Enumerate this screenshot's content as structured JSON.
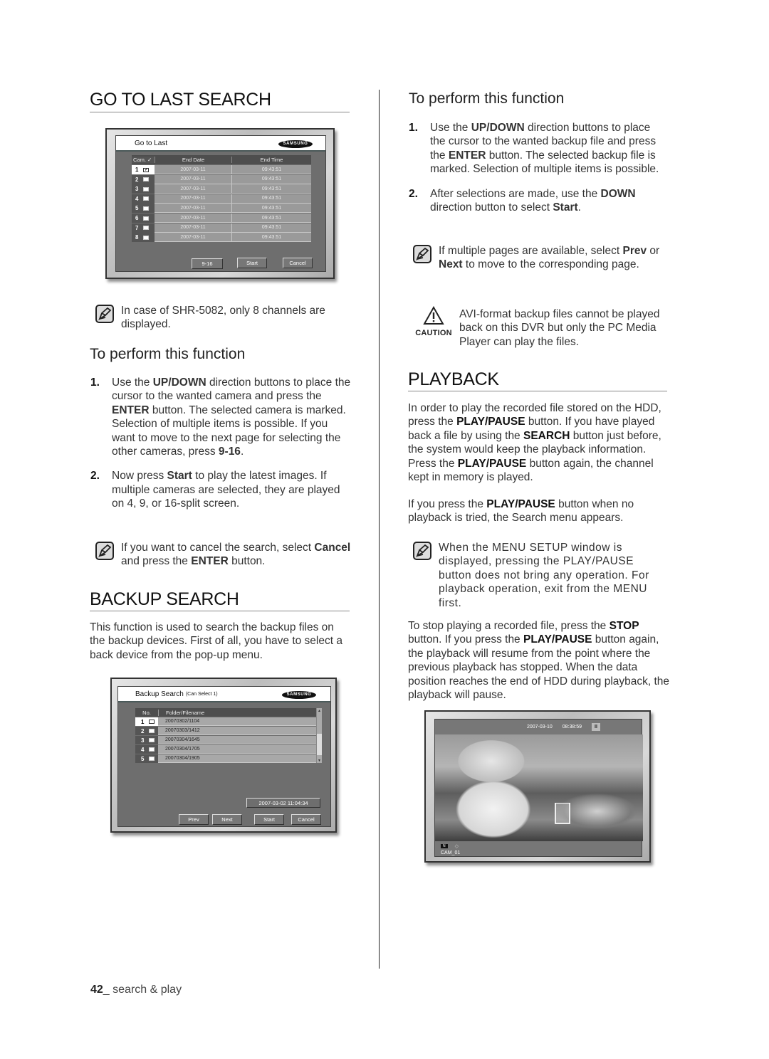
{
  "left": {
    "go_to_last": {
      "heading": "GO TO LAST SEARCH",
      "dialog": {
        "title": "Go to Last",
        "brand": "SAMSUNG",
        "columns": [
          "Cam.",
          "End Date",
          "End Time"
        ],
        "rows": [
          {
            "cam": "1",
            "checked": true,
            "date": "2007-03-11",
            "time": "09:43:51"
          },
          {
            "cam": "2",
            "checked": false,
            "date": "2007-03-11",
            "time": "09:43:51"
          },
          {
            "cam": "3",
            "checked": false,
            "date": "2007-03-11",
            "time": "09:43:51"
          },
          {
            "cam": "4",
            "checked": false,
            "date": "2007-03-11",
            "time": "09:43:51"
          },
          {
            "cam": "5",
            "checked": false,
            "date": "2007-03-11",
            "time": "09:43:51"
          },
          {
            "cam": "6",
            "checked": false,
            "date": "2007-03-11",
            "time": "09:43:51"
          },
          {
            "cam": "7",
            "checked": false,
            "date": "2007-03-11",
            "time": "09:43:51"
          },
          {
            "cam": "8",
            "checked": false,
            "date": "2007-03-11",
            "time": "09:43:51"
          }
        ],
        "buttons": {
          "page": "9-16",
          "start": "Start",
          "cancel": "Cancel"
        }
      },
      "note": "In case of SHR-5082, only 8 channels are displayed.",
      "subheading": "To perform this function",
      "steps": [
        {
          "num": "1.",
          "parts": [
            [
              "Use the ",
              false
            ],
            [
              "UP/DOWN",
              true
            ],
            [
              " direction buttons to place the cursor to the wanted camera and press the ",
              false
            ],
            [
              "ENTER",
              true
            ],
            [
              " button. The selected camera is marked. Selection of multiple items is possible. If you want to move to the next page for selecting the other cameras, press ",
              false
            ],
            [
              "9-16",
              true
            ],
            [
              ".",
              false
            ]
          ]
        },
        {
          "num": "2.",
          "parts": [
            [
              "Now press ",
              false
            ],
            [
              "Start",
              true
            ],
            [
              " to play the latest images. If multiple cameras are selected, they are played on 4, 9, or 16-split screen.",
              false
            ]
          ]
        }
      ],
      "note2_parts": [
        [
          "If you want to cancel the search, select ",
          false
        ],
        [
          "Cancel",
          true
        ],
        [
          " and press the ",
          false
        ],
        [
          "ENTER",
          true
        ],
        [
          " button.",
          false
        ]
      ]
    },
    "backup": {
      "heading": "BACKUP SEARCH",
      "intro": "This function is used to search the backup files on the backup devices. First of all, you have to select a back device from the pop-up menu.",
      "dialog": {
        "title": "Backup Search",
        "title_suffix": "(Can Select 1)",
        "brand": "SAMSUNG",
        "columns": [
          "No.",
          "Folder/Filename"
        ],
        "rows": [
          {
            "no": "1",
            "name": "20070302/1104"
          },
          {
            "no": "2",
            "name": "20070303/1412"
          },
          {
            "no": "3",
            "name": "20070304/1645"
          },
          {
            "no": "4",
            "name": "20070304/1705"
          },
          {
            "no": "5",
            "name": "20070304/1905"
          }
        ],
        "datetime": "2007-03-02  11:04:34",
        "buttons": {
          "prev": "Prev",
          "next": "Next",
          "start": "Start",
          "cancel": "Cancel"
        }
      }
    }
  },
  "right": {
    "subheading": "To perform this function",
    "steps": [
      {
        "num": "1.",
        "parts": [
          [
            "Use the ",
            false
          ],
          [
            "UP/DOWN",
            true
          ],
          [
            " direction buttons to place the cursor to the wanted backup file and press the ",
            false
          ],
          [
            "ENTER",
            true
          ],
          [
            " button. The selected backup file is marked. Selection of multiple items is possible.",
            false
          ]
        ]
      },
      {
        "num": "2.",
        "parts": [
          [
            "After selections are made, use the ",
            false
          ],
          [
            "DOWN",
            true
          ],
          [
            " direction button to select ",
            false
          ],
          [
            "Start",
            true
          ],
          [
            ".",
            false
          ]
        ]
      }
    ],
    "note_parts": [
      [
        "If multiple pages are available, select ",
        false
      ],
      [
        "Prev",
        true
      ],
      [
        " or ",
        false
      ],
      [
        "Next",
        true
      ],
      [
        " to move to the corresponding page.",
        false
      ]
    ],
    "caution": {
      "label": "CAUTION",
      "text": "AVI-format backup files cannot be played back on this DVR but only the PC Media Player can play the files."
    },
    "playback": {
      "heading": "PLAYBACK",
      "para1_parts": [
        [
          "In order to play the recorded file stored on the HDD, press the ",
          false
        ],
        [
          "PLAY/PAUSE",
          true
        ],
        [
          " button. If you have played back a file by using the ",
          false
        ],
        [
          "SEARCH",
          true
        ],
        [
          " button just before, the system would keep the playback information. Press the ",
          false
        ],
        [
          "PLAY/PAUSE",
          true
        ],
        [
          " button again, the channel kept in memory is played.",
          false
        ]
      ],
      "para2_parts": [
        [
          "If you press the ",
          false
        ],
        [
          "PLAY/PAUSE",
          true
        ],
        [
          " button when no playback is tried, the Search menu appears.",
          false
        ]
      ],
      "note": "When the MENU SETUP window is displayed, pressing the PLAY/PAUSE button does not bring any operation. For playback operation, exit from the MENU first.",
      "para3_parts": [
        [
          "To stop playing a recorded file, press the ",
          false
        ],
        [
          "STOP",
          true
        ],
        [
          " button. If you press the ",
          false
        ],
        [
          "PLAY/PAUSE",
          true
        ],
        [
          " button again, the playback will resume from the point where the previous playback has stopped. When the data position reaches the end of HDD during playback, the playback will pause.",
          false
        ]
      ],
      "screen": {
        "date": "2007-03-10",
        "time": "08:38:59",
        "status_icon": "pause-icon",
        "camera": "CAM_01"
      }
    }
  },
  "footer": {
    "page_number": "42",
    "section": "_ search & play"
  }
}
